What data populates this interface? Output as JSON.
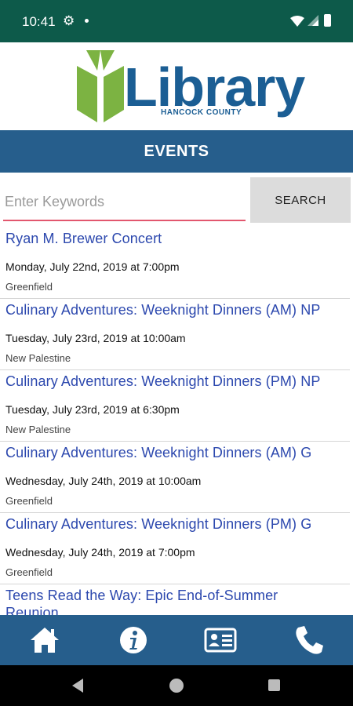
{
  "status_bar": {
    "time": "10:41"
  },
  "logo": {
    "word": "Library",
    "subtitle": "HANCOCK COUNTY"
  },
  "header": {
    "title": "EVENTS"
  },
  "search": {
    "placeholder": "Enter Keywords",
    "value": "",
    "button_label": "SEARCH"
  },
  "events": [
    {
      "title": "Ryan M. Brewer Concert",
      "date": "Monday, July 22nd, 2019 at 7:00pm",
      "location": "Greenfield"
    },
    {
      "title": "Culinary Adventures: Weeknight Dinners (AM) NP",
      "date": "Tuesday, July 23rd, 2019 at 10:00am",
      "location": "New Palestine"
    },
    {
      "title": "Culinary Adventures: Weeknight Dinners (PM) NP",
      "date": "Tuesday, July 23rd, 2019 at 6:30pm",
      "location": "New Palestine"
    },
    {
      "title": "Culinary Adventures: Weeknight Dinners (AM) G",
      "date": "Wednesday, July 24th, 2019 at 10:00am",
      "location": "Greenfield"
    },
    {
      "title": "Culinary Adventures: Weeknight Dinners (PM) G",
      "date": "Wednesday, July 24th, 2019 at 7:00pm",
      "location": "Greenfield"
    },
    {
      "title": "Teens Read the Way: Epic End-of-Summer",
      "title_line2": "Reunion",
      "date": "",
      "location": ""
    }
  ],
  "bottom_nav": [
    {
      "icon": "home-icon"
    },
    {
      "icon": "info-icon"
    },
    {
      "icon": "id-card-icon"
    },
    {
      "icon": "phone-icon"
    }
  ],
  "colors": {
    "status_bar": "#0d5a4a",
    "header": "#265e8c",
    "link": "#2c48ae",
    "logo_green": "#7cb342",
    "logo_blue": "#1b5e94",
    "search_underline": "#e2576e"
  }
}
